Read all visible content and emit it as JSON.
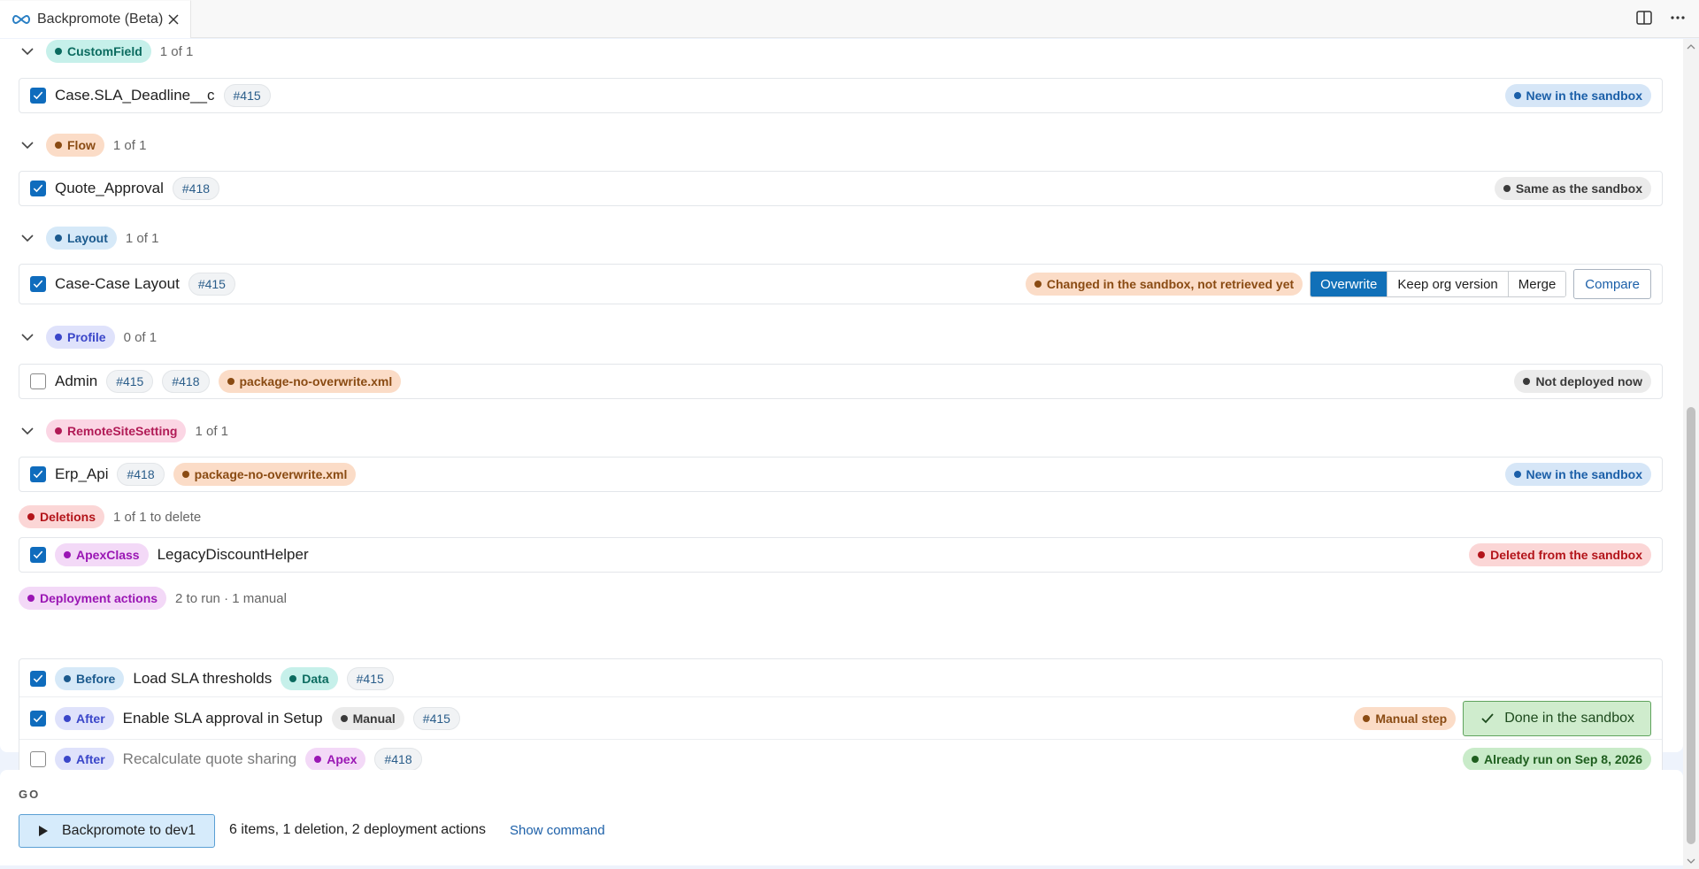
{
  "tab": {
    "title": "Backpromote (Beta)"
  },
  "groups": {
    "customfield": {
      "label": "CustomField",
      "count": "1 of 1"
    },
    "flow": {
      "label": "Flow",
      "count": "1 of 1"
    },
    "layout": {
      "label": "Layout",
      "count": "1 of 1"
    },
    "profile": {
      "label": "Profile",
      "count": "0 of 1"
    },
    "remotesite": {
      "label": "RemoteSiteSetting",
      "count": "1 of 1"
    },
    "deletions": {
      "label": "Deletions",
      "count": "1 of 1 to delete"
    },
    "actions": {
      "label": "Deployment actions",
      "count": "2 to run · 1 manual"
    }
  },
  "items": {
    "sla": {
      "name": "Case.SLA_Deadline__c",
      "pr": "#415",
      "status": "New in the sandbox",
      "checked": true
    },
    "quote": {
      "name": "Quote_Approval",
      "pr": "#418",
      "status": "Same as the sandbox",
      "checked": true
    },
    "caselayout": {
      "name": "Case-Case Layout",
      "pr": "#415",
      "status": "Changed in the sandbox, not retrieved yet",
      "checked": true,
      "options": [
        "Overwrite",
        "Keep org version",
        "Merge"
      ],
      "selected": "Overwrite",
      "compare": "Compare"
    },
    "admin": {
      "name": "Admin",
      "prs": [
        "#415",
        "#418"
      ],
      "tag": "package-no-overwrite.xml",
      "status": "Not deployed now",
      "checked": false
    },
    "erp": {
      "name": "Erp_Api",
      "pr": "#418",
      "tag": "package-no-overwrite.xml",
      "status": "New in the sandbox",
      "checked": true
    },
    "legacy": {
      "type": "ApexClass",
      "name": "LegacyDiscountHelper",
      "status": "Deleted from the sandbox",
      "checked": true
    }
  },
  "actions": [
    {
      "phase": "Before",
      "name": "Load SLA thresholds",
      "kind": "Data",
      "pr": "#415",
      "checked": true
    },
    {
      "phase": "After",
      "name": "Enable SLA approval in Setup",
      "kind": "Manual",
      "pr": "#415",
      "checked": true,
      "badge": "Manual step",
      "button": "Done in the sandbox"
    },
    {
      "phase": "After",
      "name": "Recalculate quote sharing",
      "kind": "Apex",
      "pr": "#418",
      "checked": false,
      "status": "Already run on Sep 8, 2026"
    }
  ],
  "go": {
    "label": "GO",
    "button": "Backpromote to dev1",
    "summary": "6 items, 1 deletion, 2 deployment actions",
    "link": "Show command"
  }
}
